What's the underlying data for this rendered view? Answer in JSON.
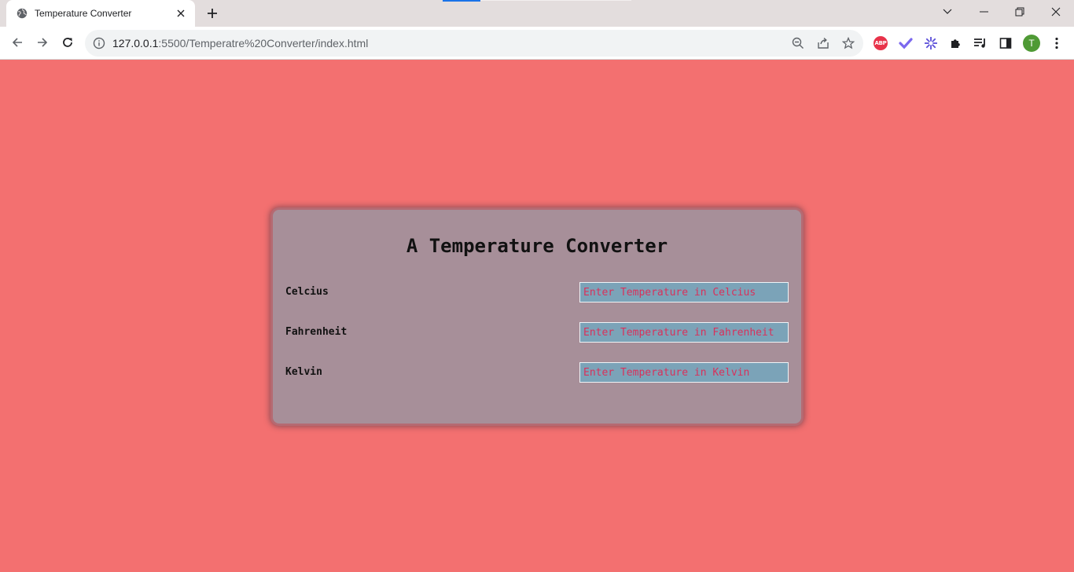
{
  "browser": {
    "tab_title": "Temperature Converter",
    "url_host": "127.0.0.1",
    "url_rest": ":5500/Temperatre%20Converter/index.html",
    "profile_initial": "T",
    "extensions": [
      "adblock-plus-icon",
      "checkmark-extension-icon",
      "asterisk-extension-icon",
      "puzzle-extensions-icon",
      "reading-list-icon",
      "side-panel-icon"
    ]
  },
  "page": {
    "title": "A Temperature Converter",
    "rows": [
      {
        "label": "Celcius",
        "placeholder": "Enter Temperature in Celcius",
        "value": ""
      },
      {
        "label": "Fahrenheit",
        "placeholder": "Enter Temperature in Fahrenheit",
        "value": ""
      },
      {
        "label": "Kelvin",
        "placeholder": "Enter Temperature in Kelvin",
        "value": ""
      }
    ]
  },
  "colors": {
    "background": "#f37070",
    "card": "#a78f99",
    "input_bg": "#7ba3b8",
    "placeholder_text": "#d8315b"
  }
}
